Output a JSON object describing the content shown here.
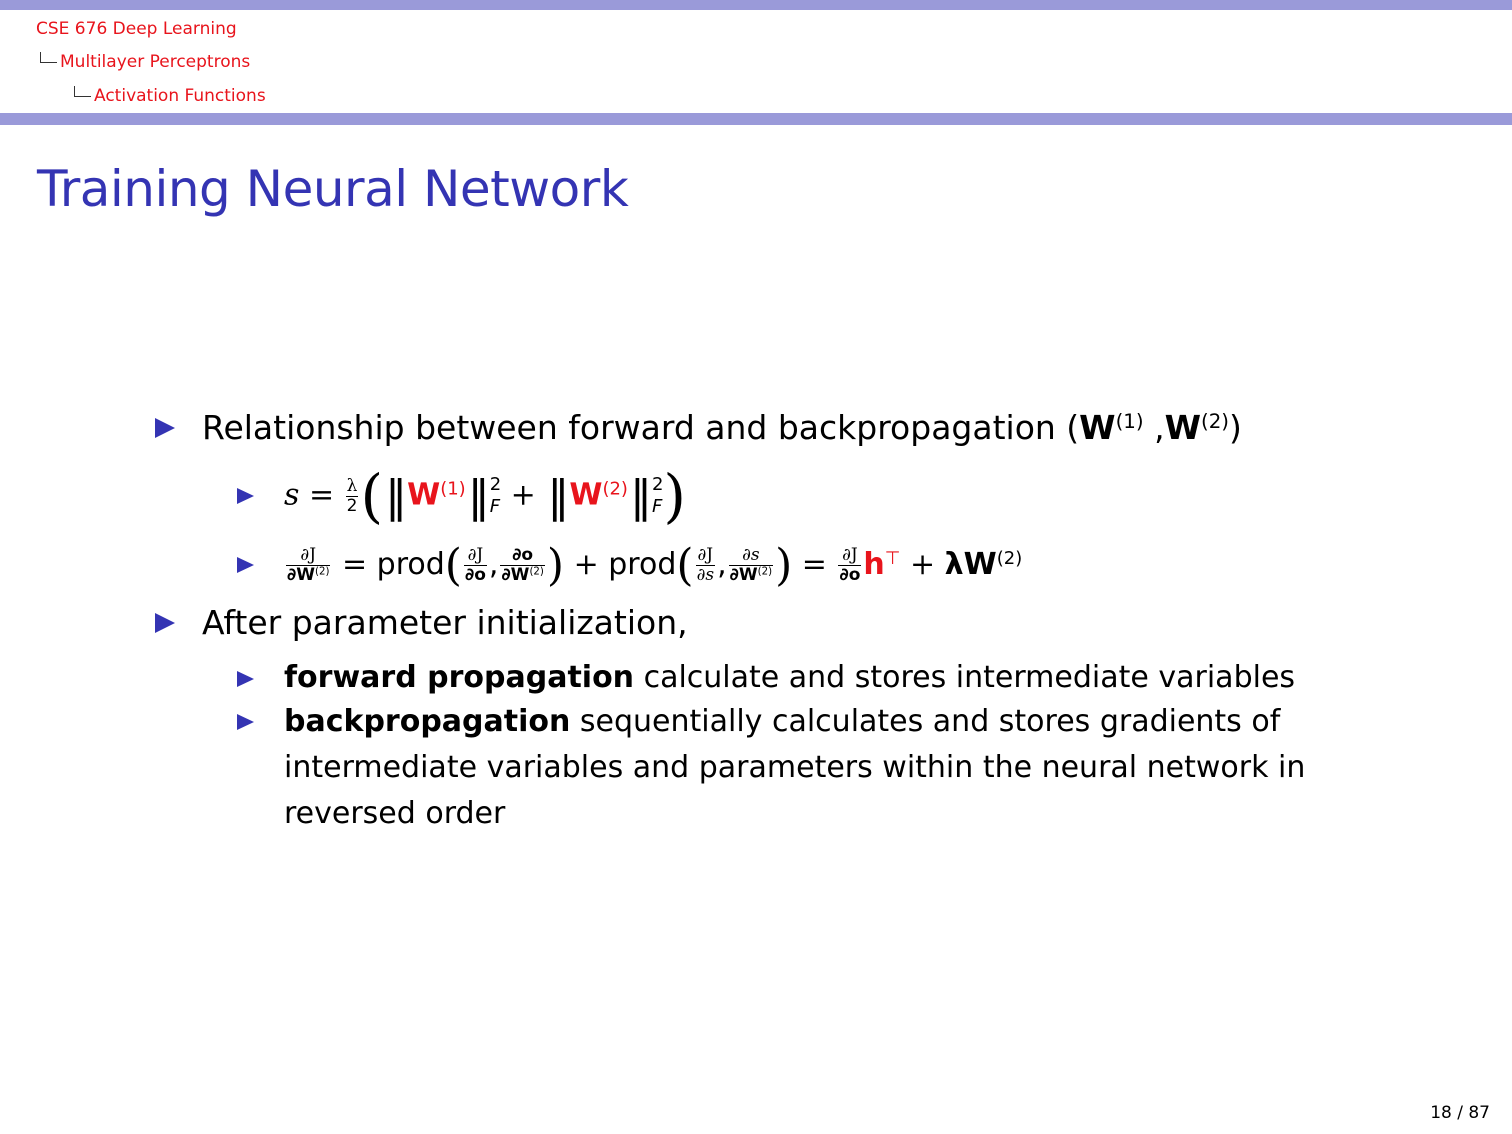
{
  "header": {
    "course": "CSE 676 Deep Learning",
    "section": "Multilayer Perceptrons",
    "subsection": "Activation Functions"
  },
  "slide": {
    "title": "Training Neural Network",
    "bullet1": {
      "text": "Relationship between forward and backpropagation (",
      "w": "W",
      "sup1": "(1)",
      "sep": " ,",
      "sup2": "(2)",
      "close": ")"
    },
    "eq1": {
      "lhs": "s",
      "eq": " = ",
      "lambda": "λ",
      "two": "2",
      "w": "W",
      "sup1": "(1)",
      "sup2": "(2)",
      "pow": "2",
      "F": "F",
      "plus": " + "
    },
    "eq2": {
      "dJ": "∂J",
      "dW2": "∂W",
      "sup2": "(2)",
      "eq": " = ",
      "prod": "prod",
      "do": "∂o",
      "ds": "∂s",
      "comma": ",",
      "plus": " + ",
      "h": "h",
      "T": "⊤",
      "lamW": "λW"
    },
    "bullet2": "After parameter initialization,",
    "sub1": {
      "bold": "forward propagation",
      "rest": " calculate and stores intermediate variables"
    },
    "sub2": {
      "bold": "backpropagation",
      "rest1": " sequentially calculates and stores gradients of",
      "rest2": "intermediate variables and parameters within the neural network in",
      "rest3": "reversed order"
    }
  },
  "footer": {
    "page": "18 / 87"
  },
  "colors": {
    "accent_blue": "#3434b3",
    "header_bar": "#9a9ad9",
    "highlight_red": "#e8141c"
  }
}
